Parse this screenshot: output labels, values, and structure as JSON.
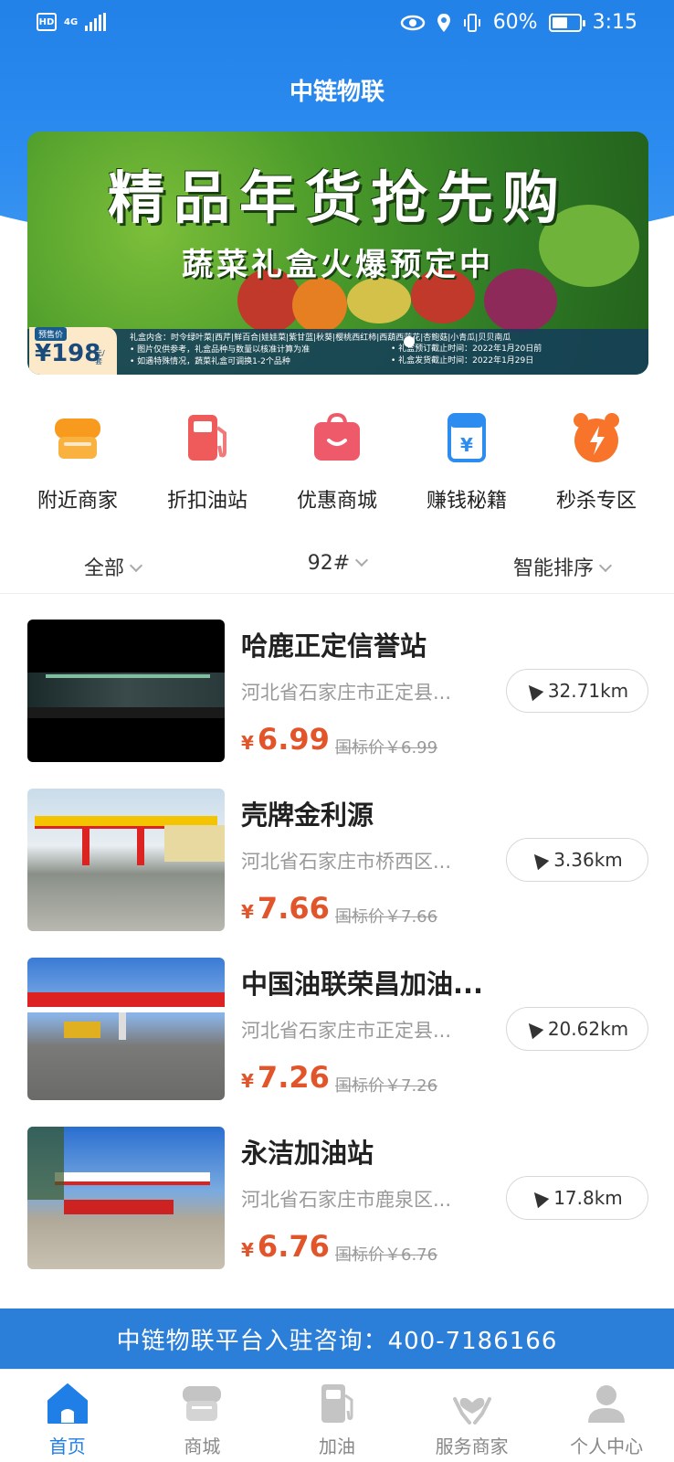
{
  "status_bar": {
    "hd": "HD",
    "network": "4G",
    "battery": "60%",
    "battery_level": 0.6,
    "time": "3:15"
  },
  "header": {
    "title": "中链物联"
  },
  "banner": {
    "title": "精品年货抢先购",
    "subtitle": "蔬菜礼盒火爆预定中",
    "presale_label": "预售价",
    "price": "¥198",
    "price_unit": "元/套",
    "info_line1": "礼盒内含：时令绿叶菜|西芹|鲜百合|娃娃菜|紫甘蓝|秋葵|樱桃西红柿|西葫西蓝花|杏鲍菇|小青瓜|贝贝南瓜",
    "info_line2": "• 图片仅供参考，礼盒品种与数量以核准计算为准",
    "info_line3": "• 如遇特殊情况，蔬菜礼盒可调换1-2个品种",
    "info_line4": "• 礼盒预订截止时间：2022年1月20日前",
    "info_line5": "• 礼盒发货截止时间：2022年1月29日"
  },
  "menu": [
    {
      "label": "附近商家",
      "icon": "store-icon",
      "color": "#f79a1e"
    },
    {
      "label": "折扣油站",
      "icon": "fuel-pump-icon",
      "color": "#ef5a5a"
    },
    {
      "label": "优惠商城",
      "icon": "shopping-bag-icon",
      "color": "#ef5a6a"
    },
    {
      "label": "赚钱秘籍",
      "icon": "money-envelope-icon",
      "color": "#2d8cf0"
    },
    {
      "label": "秒杀专区",
      "icon": "alarm-clock-icon",
      "color": "#f7742a"
    }
  ],
  "filters": [
    {
      "label": "全部"
    },
    {
      "label": "92#"
    },
    {
      "label": "智能排序"
    }
  ],
  "stations": [
    {
      "name": "哈鹿正定信誉站",
      "address": "河北省石家庄市正定县...",
      "currency": "¥",
      "price": "6.99",
      "ref_price": "国标价￥6.99",
      "distance": "32.71km"
    },
    {
      "name": "壳牌金利源",
      "address": "河北省石家庄市桥西区...",
      "currency": "¥",
      "price": "7.66",
      "ref_price": "国标价￥7.66",
      "distance": "3.36km"
    },
    {
      "name": "中国油联荣昌加油...",
      "address": "河北省石家庄市正定县...",
      "currency": "¥",
      "price": "7.26",
      "ref_price": "国标价￥7.26",
      "distance": "20.62km"
    },
    {
      "name": "永洁加油站",
      "address": "河北省石家庄市鹿泉区...",
      "currency": "¥",
      "price": "6.76",
      "ref_price": "国标价￥6.76",
      "distance": "17.8km"
    }
  ],
  "consult_bar": {
    "text": "中链物联平台入驻咨询：400-7186166"
  },
  "tabbar": [
    {
      "label": "首页",
      "icon": "home-icon",
      "active": true
    },
    {
      "label": "商城",
      "icon": "mall-icon",
      "active": false
    },
    {
      "label": "加油",
      "icon": "fuel-icon",
      "active": false
    },
    {
      "label": "服务商家",
      "icon": "heart-hands-icon",
      "active": false
    },
    {
      "label": "个人中心",
      "icon": "user-icon",
      "active": false
    }
  ],
  "colors": {
    "primary": "#1f7fe6",
    "price": "#e2542a",
    "tab_inactive": "#c4c4c4"
  }
}
